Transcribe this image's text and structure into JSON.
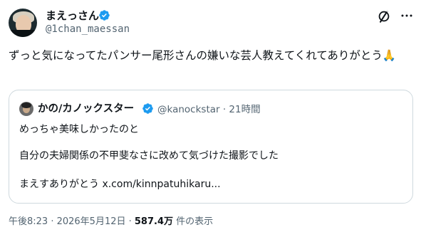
{
  "author": {
    "name": "まえっさん",
    "handle": "@1chan_maessan"
  },
  "tweet": {
    "text": "ずっと気になってたパンサー尾形さんの嫌いな芸人教えてくれてありがとう🙏"
  },
  "quote": {
    "name": "かの/カノックスター",
    "meta": "@kanockstar · 21時間",
    "lines": [
      "めっちゃ美味しかったのと",
      "自分の夫婦関係の不甲斐なさに改めて気づけた撮影でした",
      "まえすありがとう x.com/kinnpatuhikaru..."
    ]
  },
  "footer": {
    "time": "午後8:23 · 2026年5月12日 · ",
    "views": "587.4万",
    "views_suffix": " 件の表示"
  },
  "colors": {
    "verified": "#1d9bf0",
    "secondary_text": "#536471",
    "border": "#cfd9de"
  },
  "icons": [
    "verified-badge-icon",
    "grok-icon",
    "more-icon"
  ]
}
